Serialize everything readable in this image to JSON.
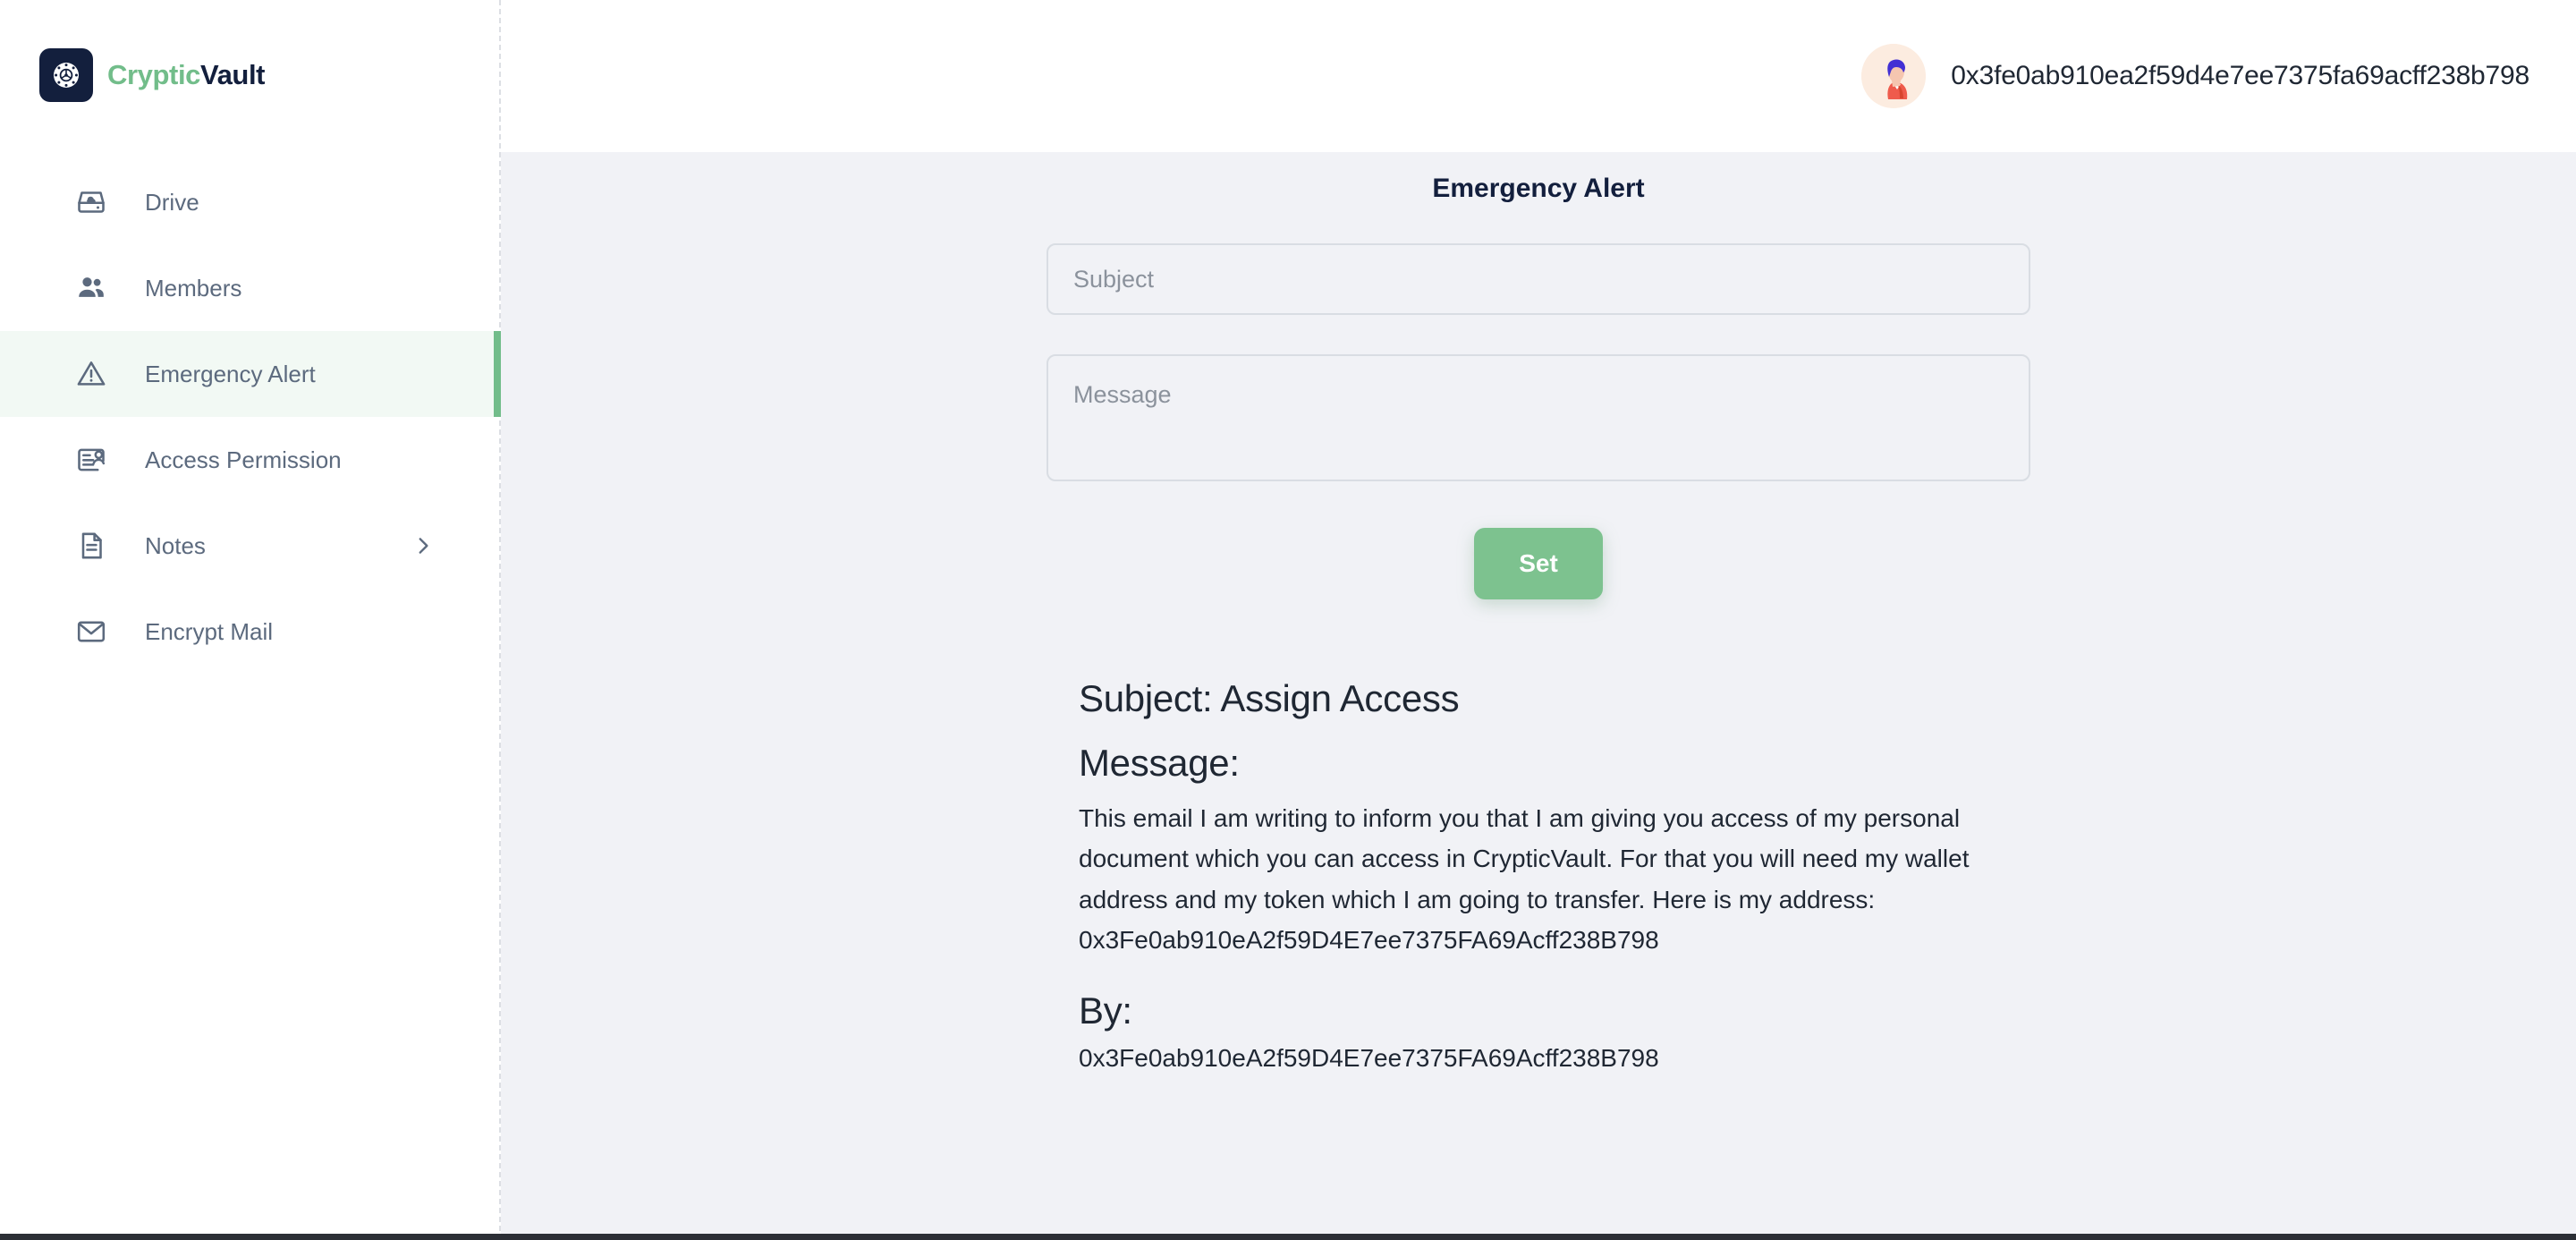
{
  "brand": {
    "name_part1": "Cryptic",
    "name_part2": "Vault",
    "logo_icon": "vault-dial-icon",
    "accent_green": "#72bd8a",
    "dark_navy": "#131f3d"
  },
  "sidebar": {
    "items": [
      {
        "label": "Drive",
        "icon": "cloud-drive-icon",
        "active": false,
        "has_chevron": false
      },
      {
        "label": "Members",
        "icon": "people-icon",
        "active": false,
        "has_chevron": false
      },
      {
        "label": "Emergency Alert",
        "icon": "warning-triangle-icon",
        "active": true,
        "has_chevron": false
      },
      {
        "label": "Access Permission",
        "icon": "id-badge-person-icon",
        "active": false,
        "has_chevron": false
      },
      {
        "label": "Notes",
        "icon": "document-lines-icon",
        "active": false,
        "has_chevron": true
      },
      {
        "label": "Encrypt Mail",
        "icon": "envelope-icon",
        "active": false,
        "has_chevron": false
      }
    ],
    "chevron_icon": "chevron-right-icon"
  },
  "topbar": {
    "avatar_icon": "user-avatar-illustration",
    "wallet_address": "0x3fe0ab910ea2f59d4e7ee7375fa69acff238b798"
  },
  "main": {
    "page_title": "Emergency Alert",
    "form": {
      "subject_placeholder": "Subject",
      "subject_value": "",
      "message_placeholder": "Message",
      "message_value": "",
      "submit_label": "Set"
    },
    "alert_preview": {
      "subject_line": "Subject: Assign Access",
      "message_label": "Message:",
      "message_body": "This email I am writing to inform you that I am giving you access of my personal document which you can access in CrypticVault. For that you will need my wallet address and my token which I am going to transfer. Here is my address:",
      "message_address": "0x3Fe0ab910eA2f59D4E7ee7375FA69Acff238B798",
      "by_label": "By:",
      "by_address": "0x3Fe0ab910eA2f59D4E7ee7375FA69Acff238B798"
    }
  },
  "colors": {
    "page_background": "#f1f2f6",
    "sidebar_background": "#ffffff",
    "active_item_background": "#f2f9f4",
    "active_indicator": "#72bd8a",
    "button_green": "#7dc28f",
    "text_muted": "#5c6a7e"
  }
}
